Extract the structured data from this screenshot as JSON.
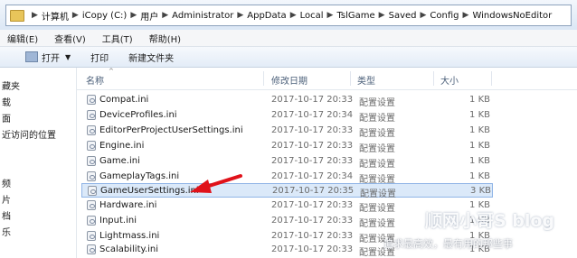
{
  "address": {
    "crumbs": [
      "计算机",
      "iCopy (C:)",
      "用户",
      "Administrator",
      "AppData",
      "Local",
      "TslGame",
      "Saved",
      "Config",
      "WindowsNoEditor"
    ]
  },
  "menu": [
    "编辑(E)",
    "查看(V)",
    "工具(T)",
    "帮助(H)"
  ],
  "toolbar": {
    "open": "打开",
    "print": "打印",
    "new_folder": "新建文件夹"
  },
  "nav": [
    "藏夹",
    "载",
    "面",
    "近访问的位置",
    "频",
    "片",
    "档",
    "乐"
  ],
  "columns": {
    "name": "名称",
    "date": "修改日期",
    "type": "类型",
    "size": "大小"
  },
  "files": [
    {
      "name": "Compat.ini",
      "date": "2017-10-17 20:33",
      "type": "配置设置",
      "size": "1 KB"
    },
    {
      "name": "DeviceProfiles.ini",
      "date": "2017-10-17 20:34",
      "type": "配置设置",
      "size": "1 KB"
    },
    {
      "name": "EditorPerProjectUserSettings.ini",
      "date": "2017-10-17 20:33",
      "type": "配置设置",
      "size": "1 KB"
    },
    {
      "name": "Engine.ini",
      "date": "2017-10-17 20:33",
      "type": "配置设置",
      "size": "1 KB"
    },
    {
      "name": "Game.ini",
      "date": "2017-10-17 20:33",
      "type": "配置设置",
      "size": "1 KB"
    },
    {
      "name": "GameplayTags.ini",
      "date": "2017-10-17 20:34",
      "type": "配置设置",
      "size": "1 KB"
    },
    {
      "name": "GameUserSettings.ini",
      "date": "2017-10-17 20:35",
      "type": "配置设置",
      "size": "3 KB"
    },
    {
      "name": "Hardware.ini",
      "date": "2017-10-17 20:33",
      "type": "配置设置",
      "size": "1 KB"
    },
    {
      "name": "Input.ini",
      "date": "2017-10-17 20:33",
      "type": "配置设置",
      "size": "1 KB"
    },
    {
      "name": "Lightmass.ini",
      "date": "2017-10-17 20:33",
      "type": "配置设置",
      "size": "1 KB"
    },
    {
      "name": "Scalability.ini",
      "date": "2017-10-17 20:33",
      "type": "配置设置",
      "size": "1 KB"
    }
  ],
  "selected_file": "GameUserSettings.ini",
  "watermark": {
    "title": "顺网小哥S blog",
    "subtitle": "追求最高效，最有用的那些事"
  },
  "colors": {
    "arrow": "#e0121a",
    "selection": "#dbe9f9"
  }
}
